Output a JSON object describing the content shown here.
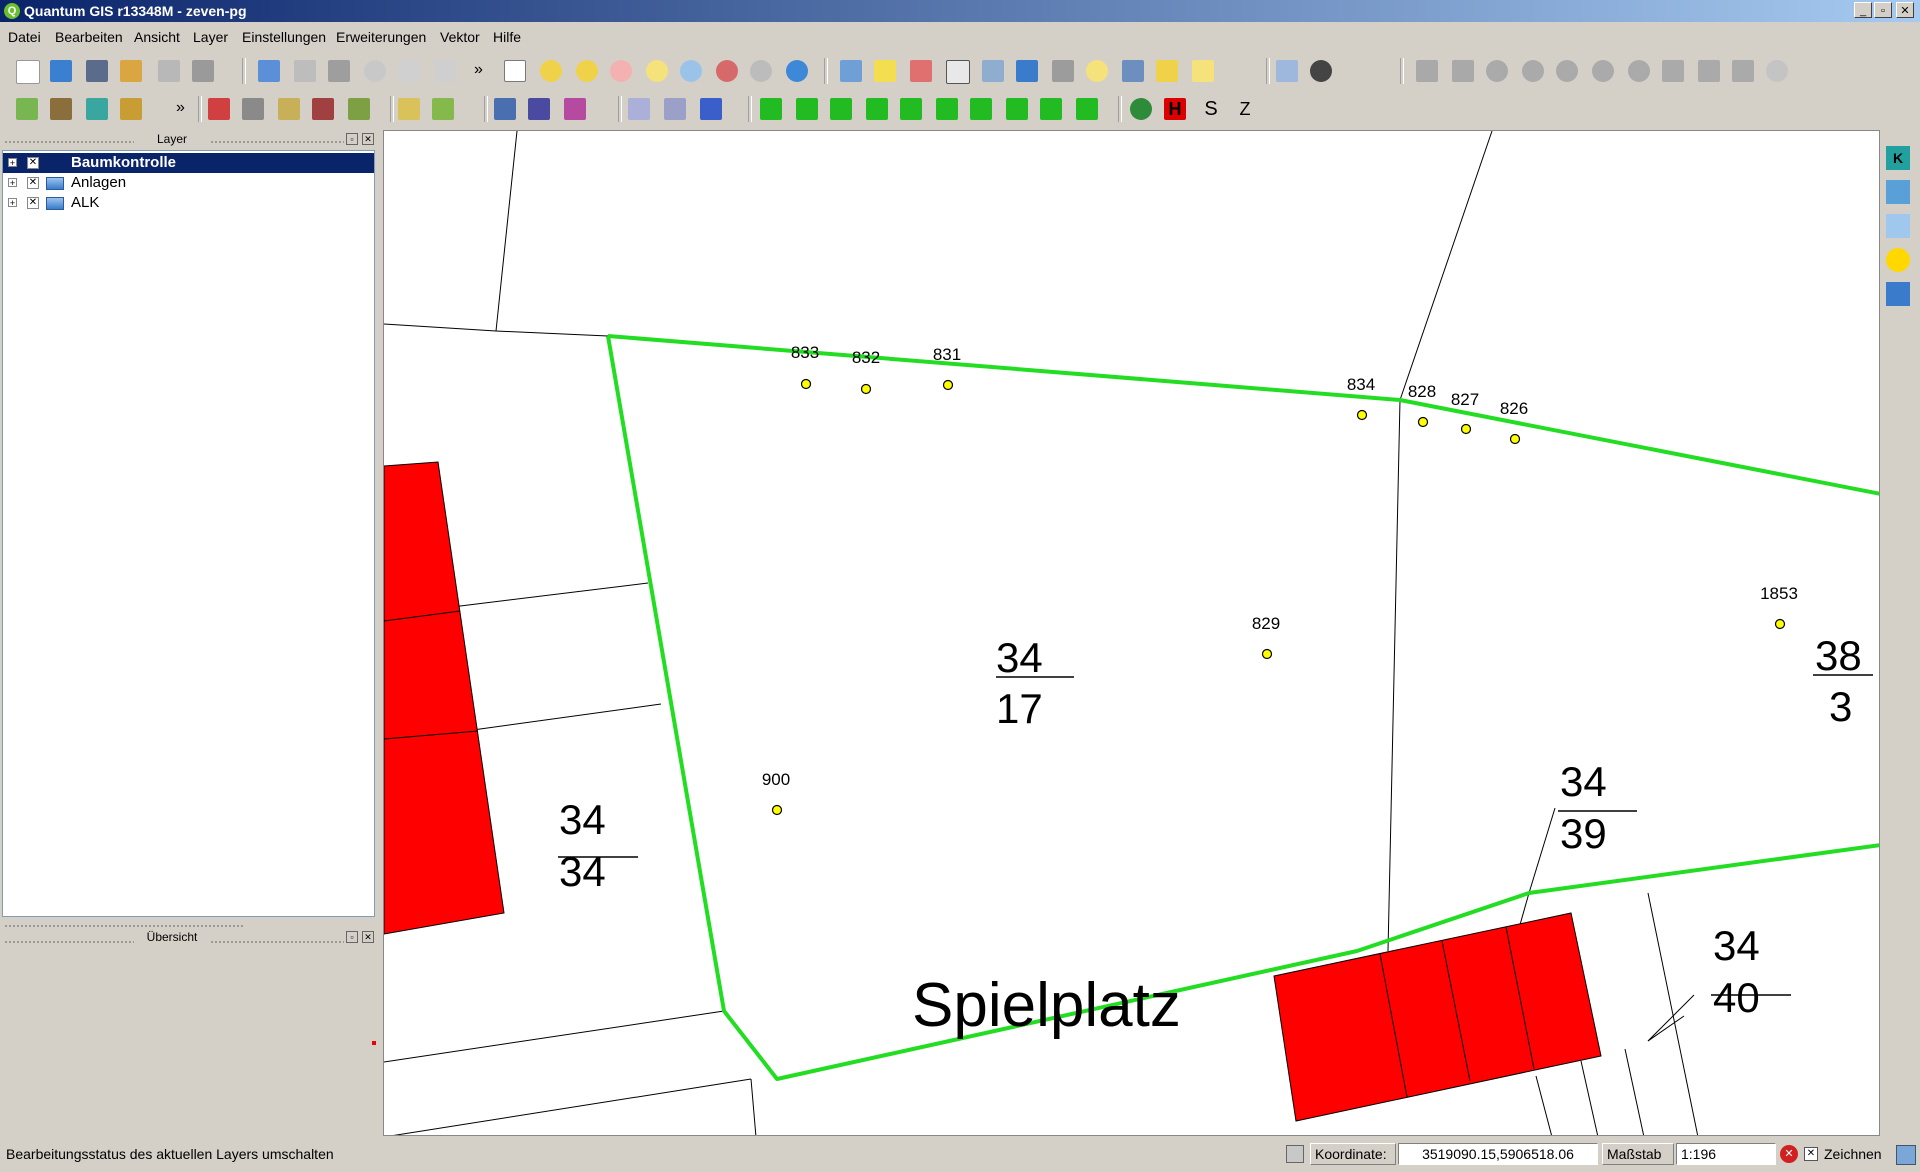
{
  "window": {
    "title": "Quantum GIS r13348M - zeven-pg"
  },
  "menu": [
    "Datei",
    "Bearbeiten",
    "Ansicht",
    "Layer",
    "Einstellungen",
    "Erweiterungen",
    "Vektor",
    "Hilfe"
  ],
  "panels": {
    "layer_title": "Layer",
    "overview_title": "Übersicht",
    "layers": [
      {
        "name": "Baumkontrolle",
        "selected": true
      },
      {
        "name": "Anlagen",
        "selected": false
      },
      {
        "name": "ALK",
        "selected": false
      }
    ]
  },
  "map": {
    "trees": [
      {
        "id": "833"
      },
      {
        "id": "832"
      },
      {
        "id": "831"
      },
      {
        "id": "834"
      },
      {
        "id": "828"
      },
      {
        "id": "827"
      },
      {
        "id": "826"
      },
      {
        "id": "829"
      },
      {
        "id": "1853"
      },
      {
        "id": "900"
      }
    ],
    "parcels": {
      "p3417": {
        "top": "34",
        "bottom": "17"
      },
      "p383": {
        "top": "38",
        "bottom": "3"
      },
      "p3439": {
        "top": "34",
        "bottom": "39"
      },
      "p3434": {
        "top": "34",
        "bottom": "34"
      },
      "p3440": {
        "top": "34",
        "bottom": "40"
      }
    },
    "area_label": "Spielplatz",
    "colors": {
      "boundary": "#22dd22",
      "building": "#ff0000",
      "tree": "#ffff00"
    }
  },
  "toolbar": {
    "overflow": "»",
    "z_label": "Z",
    "dollar_label": "S",
    "h_label": "H"
  },
  "status": {
    "message": "Bearbeitungsstatus des aktuellen Layers umschalten",
    "coord_label": "Koordinate:",
    "coord_value": "3519090.15,5906518.06",
    "scale_label": "Maßstab",
    "scale_value": "1:196",
    "render_label": "Zeichnen"
  }
}
